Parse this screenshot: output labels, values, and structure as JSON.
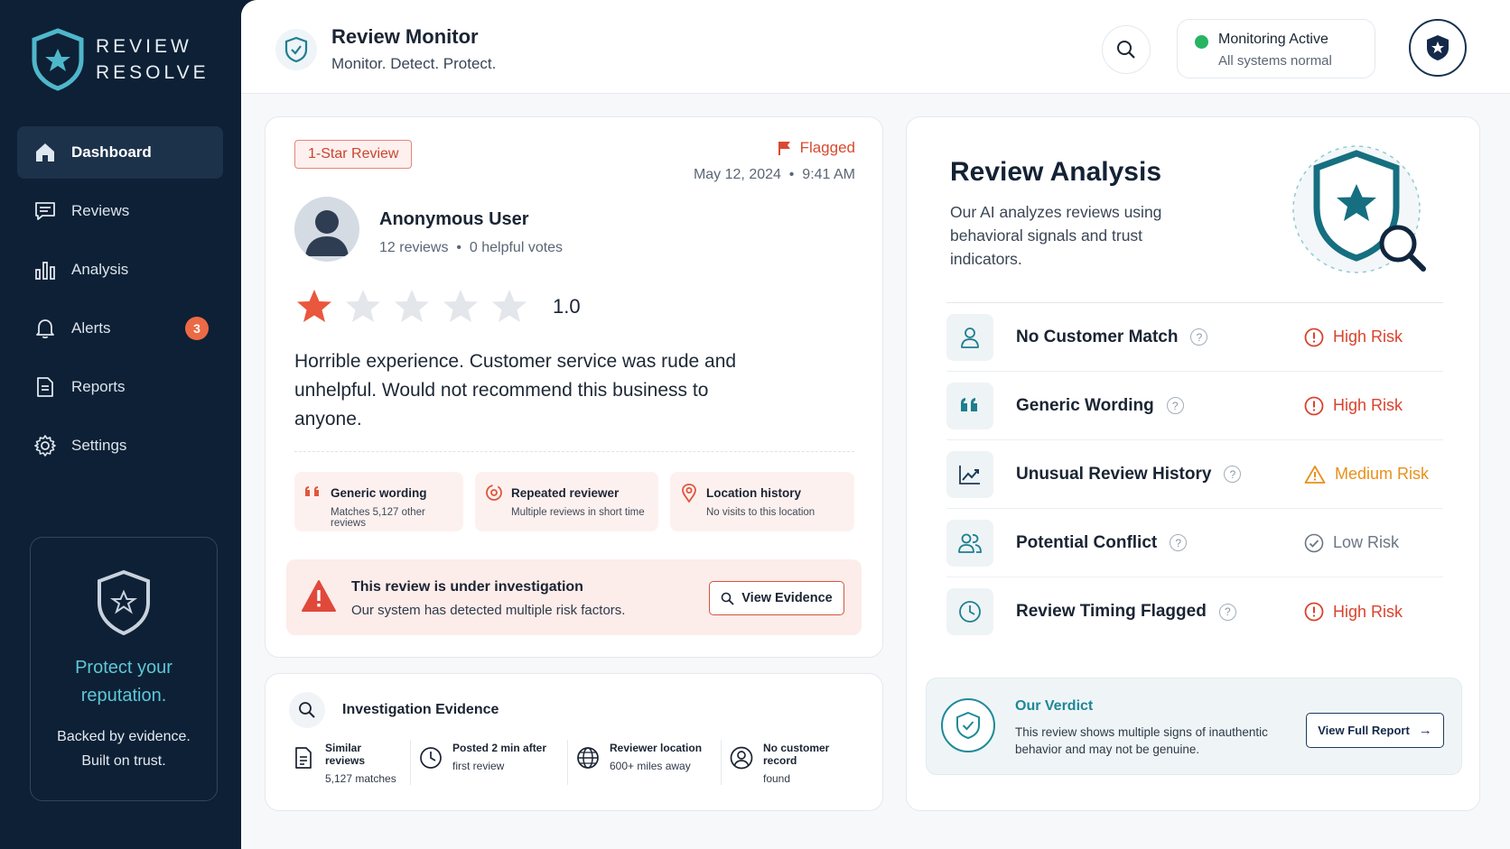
{
  "brand": {
    "line1": "REVIEW",
    "line2": "RESOLVE",
    "icon": "shield-star-icon"
  },
  "sidebar": {
    "items": [
      {
        "label": "Dashboard",
        "icon": "home-icon",
        "active": true
      },
      {
        "label": "Reviews",
        "icon": "message-icon"
      },
      {
        "label": "Analysis",
        "icon": "bar-chart-icon"
      },
      {
        "label": "Alerts",
        "icon": "bell-icon",
        "badge": "3"
      },
      {
        "label": "Reports",
        "icon": "document-icon"
      },
      {
        "label": "Settings",
        "icon": "gear-icon"
      }
    ],
    "promo": {
      "title": "Protect your reputation.",
      "subtitle": "Backed by evidence. Built on trust."
    }
  },
  "header": {
    "title": "Review Monitor",
    "subtitle": "Monitor. Detect. Protect.",
    "status_title": "Monitoring Active",
    "status_sub": "All systems normal"
  },
  "review": {
    "tag": "1-Star Review",
    "flag": "Flagged",
    "date": "May 12, 2024",
    "time": "9:41 AM",
    "user": "Anonymous User",
    "reviews_count": "12 reviews",
    "helpful": "0 helpful votes",
    "rating": 1,
    "rating_text": "1.0",
    "text": "Horrible experience. Customer service was rude and unhelpful. Would not recommend this business to anyone.",
    "signals": [
      {
        "title": "Generic wording",
        "sub": "Matches 5,127 other reviews",
        "icon": "quote-icon"
      },
      {
        "title": "Repeated reviewer",
        "sub": "Multiple reviews in short time",
        "icon": "repeat-icon"
      },
      {
        "title": "Location history",
        "sub": "No visits to this location",
        "icon": "location-pin-icon"
      }
    ],
    "investigation": {
      "title": "This review is under investigation",
      "sub": "Our system has detected multiple risk factors.",
      "button": "View Evidence"
    }
  },
  "evidence": {
    "title": "Investigation Evidence",
    "items": [
      {
        "title": "Similar reviews",
        "sub": "5,127 matches",
        "icon": "document-icon"
      },
      {
        "title": "Posted 2 min after",
        "sub": "first review",
        "icon": "clock-icon"
      },
      {
        "title": "Reviewer location",
        "sub": "600+ miles away",
        "icon": "globe-icon"
      },
      {
        "title": "No customer record",
        "sub": "found",
        "icon": "user-circle-icon"
      }
    ]
  },
  "analysis": {
    "title": "Review Analysis",
    "subtitle": "Our AI analyzes reviews using behavioral signals and trust indicators.",
    "factors": [
      {
        "label": "No Customer Match",
        "risk": "High Risk",
        "level": "high",
        "icon": "user-icon"
      },
      {
        "label": "Generic Wording",
        "risk": "High Risk",
        "level": "high",
        "icon": "quote-icon"
      },
      {
        "label": "Unusual Review History",
        "risk": "Medium Risk",
        "level": "medium",
        "icon": "trend-icon"
      },
      {
        "label": "Potential Conflict",
        "risk": "Low Risk",
        "level": "low",
        "icon": "users-icon"
      },
      {
        "label": "Review Timing Flagged",
        "risk": "High Risk",
        "level": "high",
        "icon": "clock-icon"
      }
    ],
    "verdict": {
      "title": "Our Verdict",
      "text": "This review shows multiple signs of inauthentic behavior and may not be genuine.",
      "button": "View Full Report"
    }
  },
  "colors": {
    "high": "#d9432e",
    "medium": "#e8901c",
    "low": "#6b7683",
    "accent": "#1d8796",
    "sidebar": "#0e2035"
  }
}
